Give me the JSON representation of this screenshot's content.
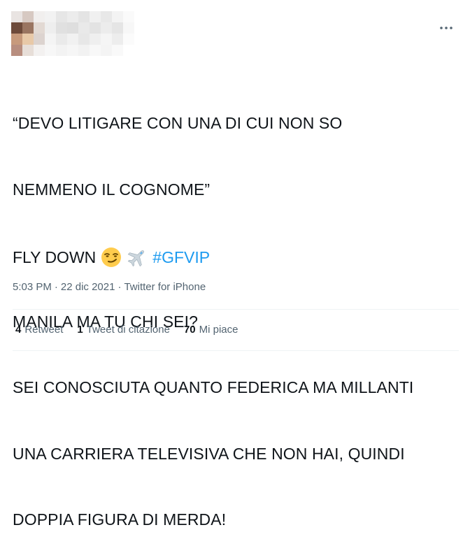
{
  "tweet": {
    "lines": [
      "“DEVO LITIGARE CON UNA DI CUI NON SO",
      "NEMMENO IL COGNOME”",
      "",
      "MANILA MA TU CHI SEI?",
      "SEI CONOSCIUTA QUANTO FEDERICA MA MILLANTI",
      "UNA CARRIERA TELEVISIVA CHE NON HAI, QUINDI",
      "DOPPIA FIGURA DI MERDA!",
      ""
    ],
    "last_line_text": "FLY DOWN",
    "emojis": [
      "smirking-face-icon",
      "airplane-icon"
    ],
    "hashtag": "#GFVIP"
  },
  "meta": {
    "time": "5:03 PM",
    "separator": "·",
    "date": "22 dic 2021",
    "source": "Twitter for iPhone"
  },
  "stats": {
    "retweets_count": "4",
    "retweets_label": "Retweet",
    "quotes_count": "1",
    "quotes_label": "Tweet di citazione",
    "likes_count": "70",
    "likes_label": "Mi piace"
  },
  "colors": {
    "text": "#0f1419",
    "secondary": "#536471",
    "link": "#1d9bf0",
    "divider": "#eff3f4"
  }
}
